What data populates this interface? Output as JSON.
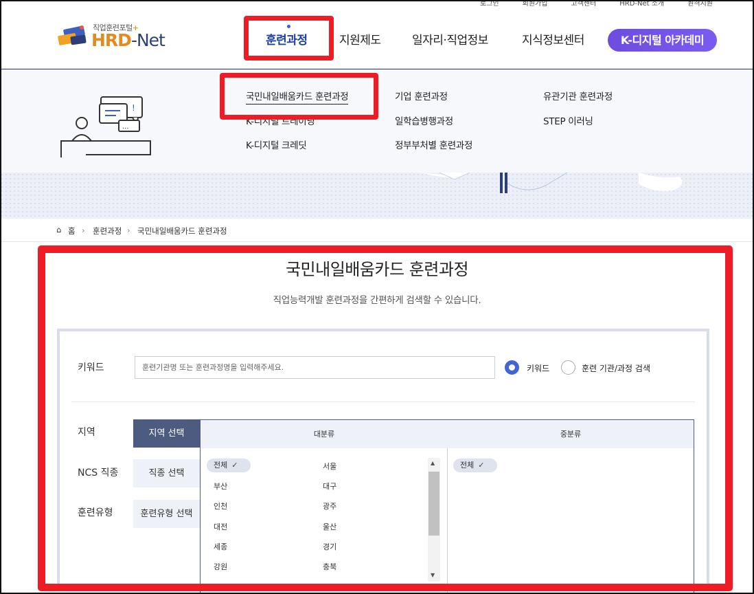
{
  "util_links": [
    "로그인",
    "회원가입",
    "고객센터",
    "HRD-Net 소개",
    "원격지원"
  ],
  "logo": {
    "tagline": "직업훈련포털",
    "brand_a": "HRD",
    "brand_b": "-Net"
  },
  "nav": {
    "items": [
      "훈련과정",
      "지원제도",
      "일자리·직업정보",
      "지식정보센터"
    ],
    "special": "K-디지털 아카데미"
  },
  "mega": {
    "col1": [
      "국민내일배움카드 훈련과정",
      "K-디지털 트레이닝",
      "K-디지털 크레딧"
    ],
    "col2": [
      "기업 훈련과정",
      "일학습병행과정",
      "정부부처별 훈련과정"
    ],
    "col3": [
      "유관기관 훈련과정",
      "STEP 이러닝"
    ]
  },
  "breadcrumb": {
    "home": "홈",
    "level1": "훈련과정",
    "level2": "국민내일배움카드 훈련과정"
  },
  "page": {
    "title": "국민내일배움카드 훈련과정",
    "desc": "직업능력개발 훈련과정을 간편하게 검색할 수 있습니다."
  },
  "search": {
    "keyword_label": "키워드",
    "keyword_placeholder": "훈련기관명 또는 훈련과정명을 입력해주세요.",
    "radio1": "키워드",
    "radio2": "훈련 기관/과정 검색",
    "region_label": "지역",
    "ncs_label": "NCS 직종",
    "type_label": "훈련유형",
    "tab_region": "지역 선택",
    "tab_ncs": "직종 선택",
    "tab_type": "훈련유형 선택",
    "col_major": "대분류",
    "col_middle": "중분류",
    "major_left": [
      "전체",
      "부산",
      "인천",
      "대전",
      "세종",
      "강원"
    ],
    "major_right": [
      "서울",
      "대구",
      "광주",
      "울산",
      "경기",
      "충북"
    ],
    "middle": [
      "전체"
    ]
  },
  "colors": {
    "highlight": "#ee1c25",
    "nav_active": "#1a3f9c",
    "tab_active": "#4d5b80",
    "radio": "#4165d8"
  }
}
